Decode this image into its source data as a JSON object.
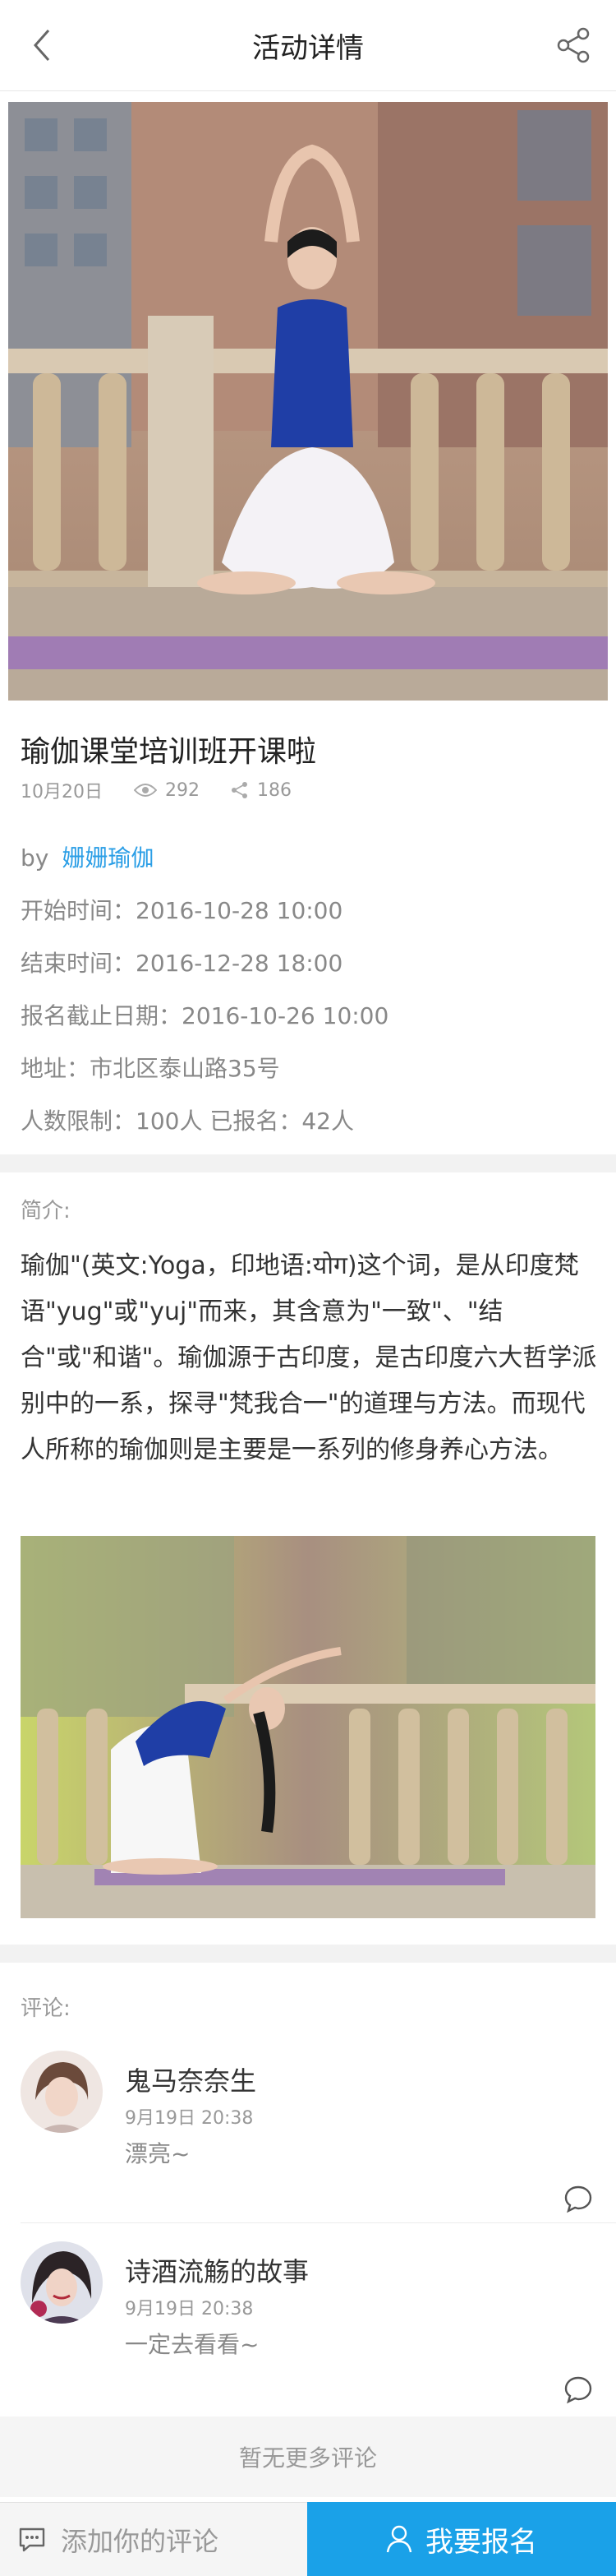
{
  "header": {
    "title": "活动详情"
  },
  "activity": {
    "title": "瑜伽课堂培训班开课啦",
    "date": "10月20日",
    "views": "292",
    "shares": "186",
    "by_prefix": "by",
    "organizer": "姗姗瑜伽",
    "start": "开始时间：2016-10-28 10:00",
    "end": "结束时间：2016-12-28 18:00",
    "deadline": "报名截止日期：2016-10-26  10:00",
    "address": "地址：市北区泰山路35号",
    "capacity": "人数限制：100人  已报名：42人"
  },
  "intro": {
    "label": "简介:",
    "text": "瑜伽\"(英文:Yoga，印地语:योग)这个词，是从印度梵语\"yug\"或\"yuj\"而来，其含意为\"一致\"、\"结合\"或\"和谐\"。瑜伽源于古印度，是古印度六大哲学派别中的一系，探寻\"梵我合一\"的道理与方法。而现代人所称的瑜伽则是主要是一系列的修身养心方法。"
  },
  "comments": {
    "label": "评论:",
    "items": [
      {
        "name": "鬼马奈奈生",
        "time": "9月19日 20:38",
        "text": "漂亮~"
      },
      {
        "name": "诗酒流觞的故事",
        "time": "9月19日 20:38",
        "text": "一定去看看~"
      }
    ],
    "no_more": "暂无更多评论"
  },
  "bottom": {
    "add_comment": "添加你的评论",
    "signup": "我要报名"
  },
  "colors": {
    "accent": "#1aa1e8",
    "link": "#2a9ee6"
  }
}
